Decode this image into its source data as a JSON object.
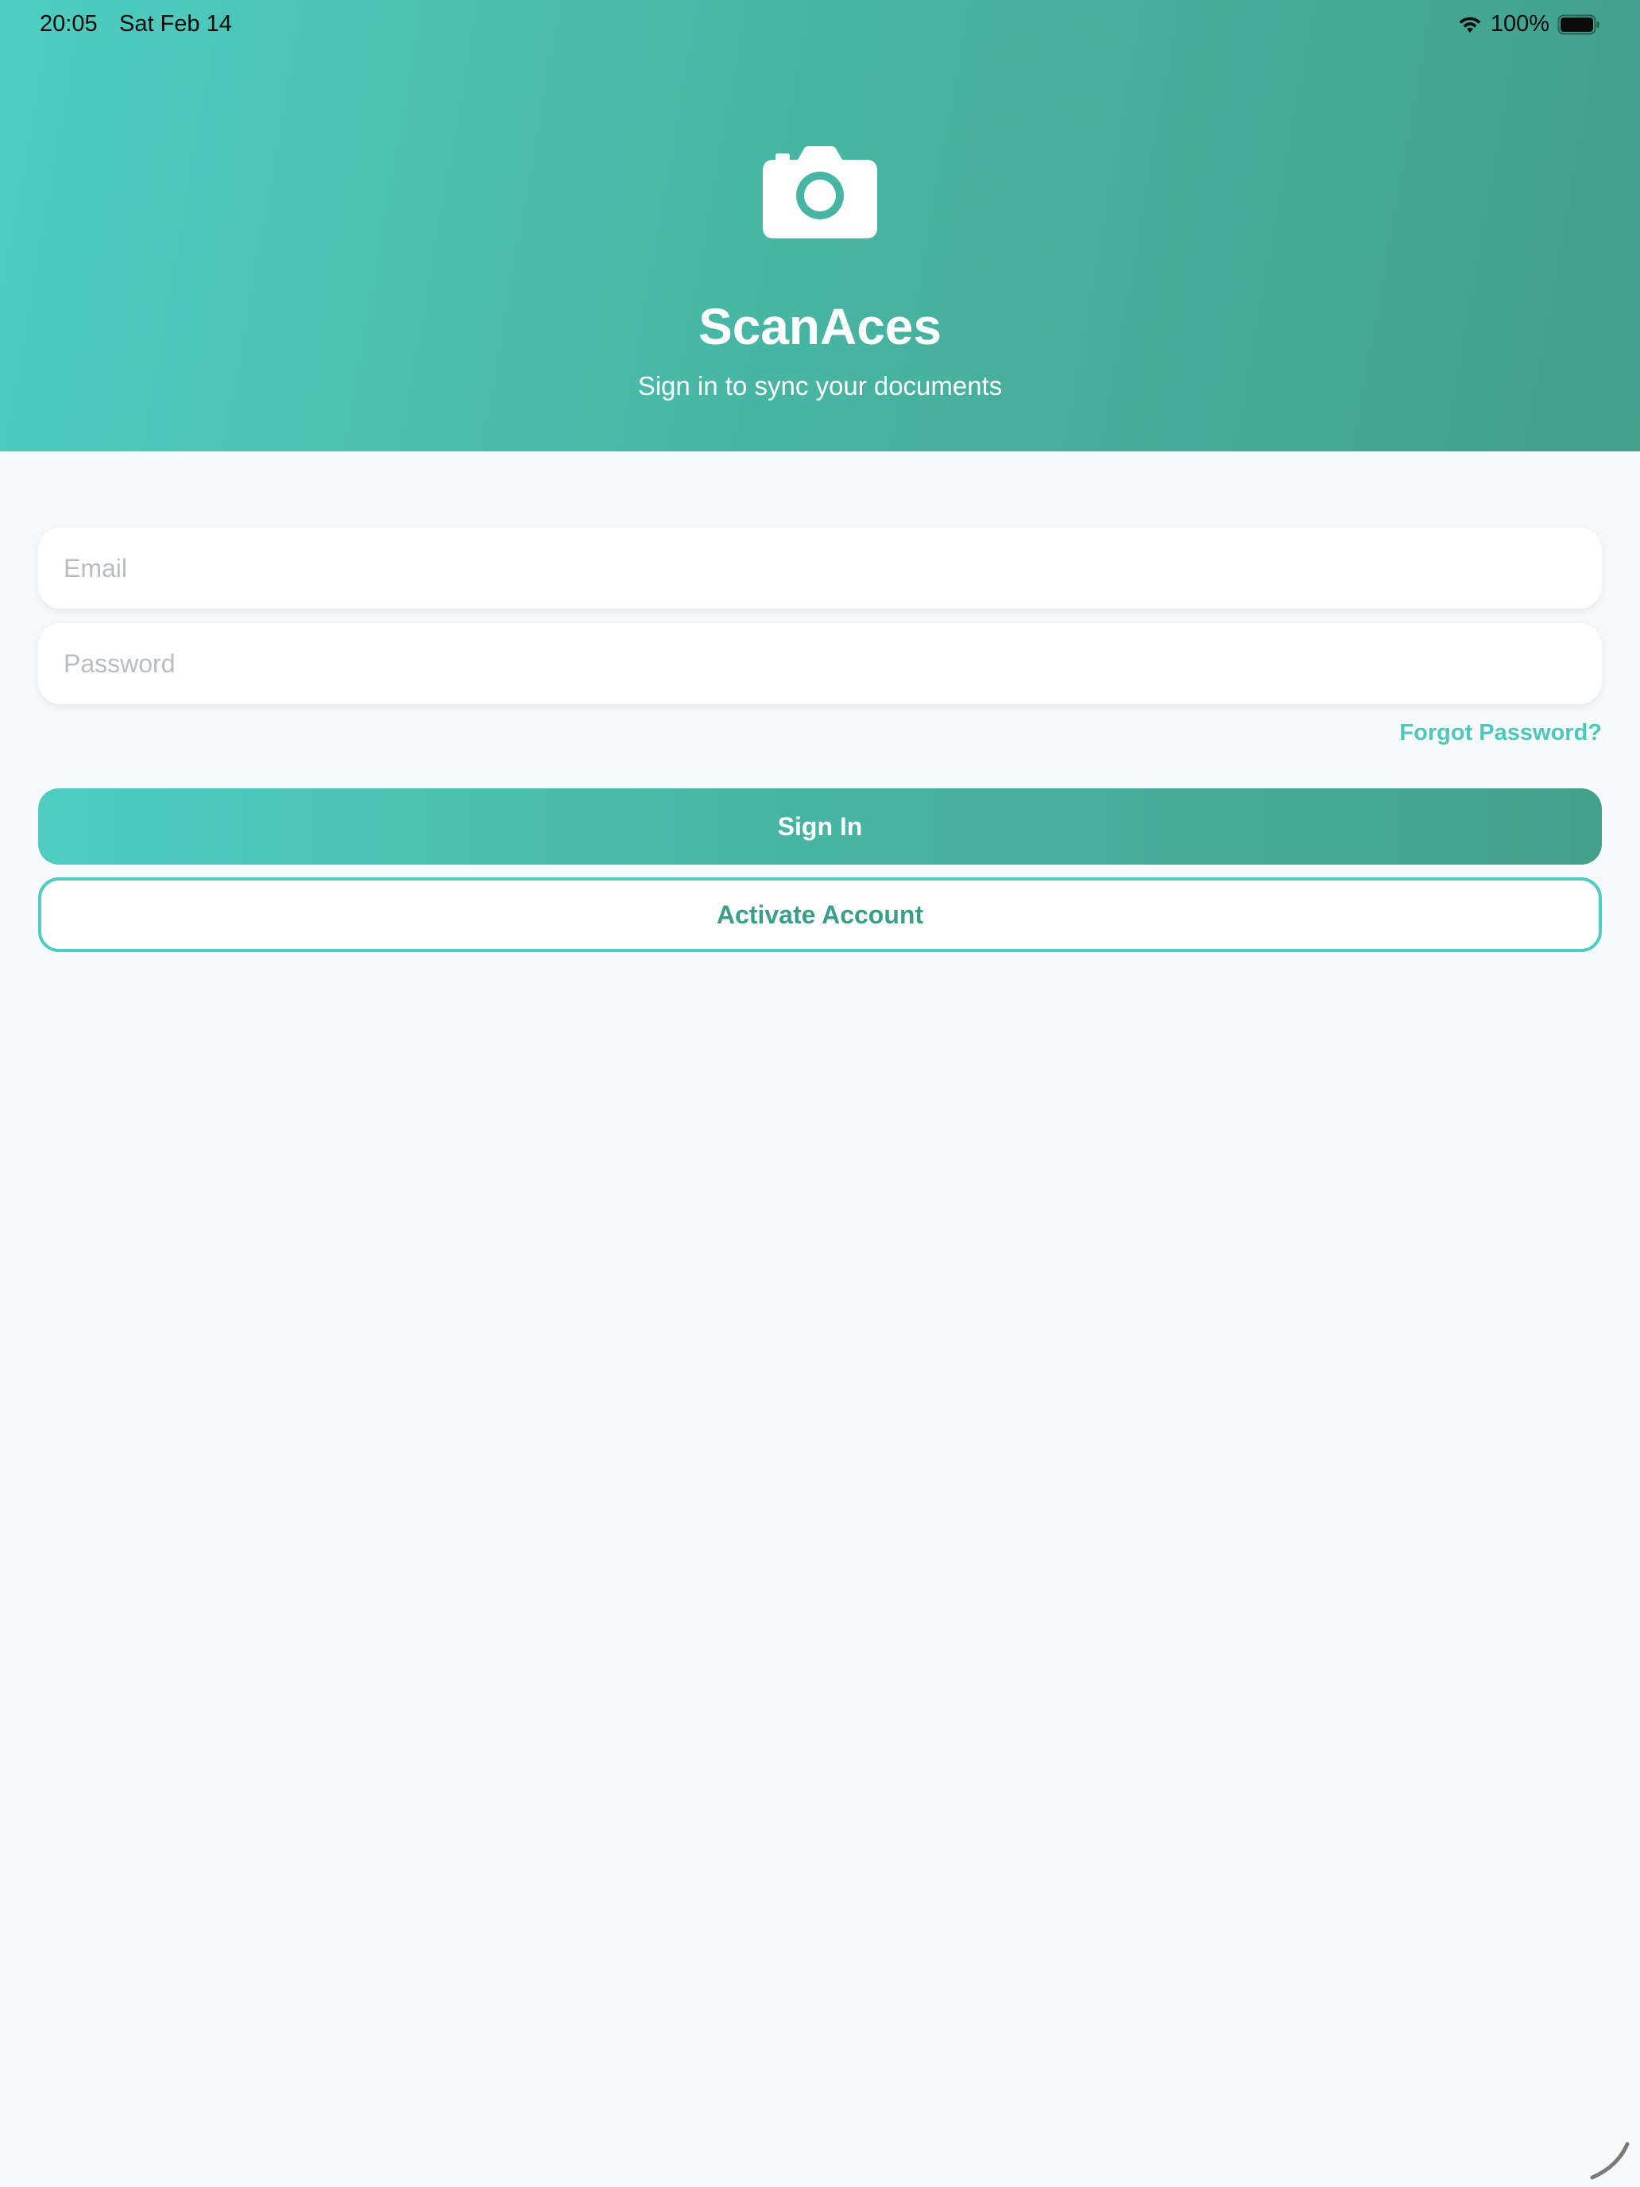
{
  "status_bar": {
    "time": "20:05",
    "date": "Sat Feb 14",
    "battery": "100%"
  },
  "header": {
    "icon": "camera-icon",
    "title": "ScanAces",
    "subtitle": "Sign in to sync your documents"
  },
  "form": {
    "email_placeholder": "Email",
    "email_value": "",
    "password_placeholder": "Password",
    "password_value": "",
    "forgot_label": "Forgot Password?"
  },
  "actions": {
    "sign_in_label": "Sign In",
    "activate_label": "Activate Account"
  },
  "colors": {
    "accent_start": "#4ecdc0",
    "accent_end": "#42a08b",
    "link": "#4cc8bb",
    "background": "#f7f9fb"
  }
}
